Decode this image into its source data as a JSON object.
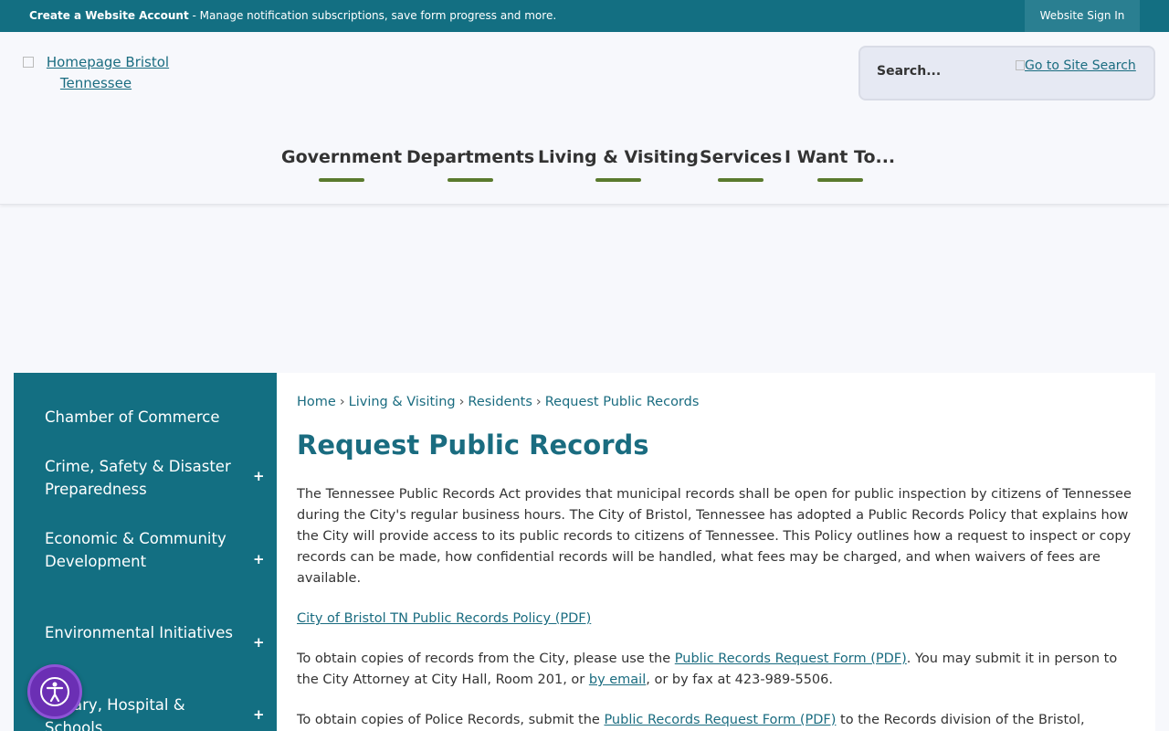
{
  "topbar": {
    "create_account": "Create a Website Account",
    "message": " - Manage notification subscriptions, save form progress and more.",
    "signin": "Website Sign In"
  },
  "header": {
    "logo_alt": "Homepage Bristol Tennessee",
    "search_placeholder": "Search...",
    "search_go": "Go to Site Search"
  },
  "nav": [
    "Government",
    "Departments",
    "Living & Visiting",
    "Services",
    "I Want To..."
  ],
  "sidebar": [
    {
      "label": "Chamber of Commerce",
      "expandable": false
    },
    {
      "label": "Crime, Safety & Disaster Preparedness",
      "expandable": true
    },
    {
      "label": "Economic & Community Development",
      "expandable": true
    },
    {
      "label": "Environmental Initiatives",
      "expandable": true
    },
    {
      "label": "Library, Hospital & Schools",
      "expandable": true
    }
  ],
  "breadcrumb": [
    "Home",
    "Living & Visiting",
    "Residents",
    "Request Public Records"
  ],
  "page_title": "Request Public Records",
  "content": {
    "intro": "The Tennessee Public Records Act provides that municipal records shall be open for public inspection by citizens of Tennessee during the City's regular business hours. The City of Bristol, Tennessee has adopted a Public Records Policy that explains how the City will provide access to its public records to citizens of Tennessee. This Policy outlines how a request to inspect or copy records can be made, how confidential records will be handled, what fees may be charged, and when waivers of fees are available.",
    "policy_link": "City of Bristol TN Public Records Policy (PDF)",
    "p2_a": "To obtain copies of records from the City, please use the ",
    "p2_link": "Public Records Request Form (PDF)",
    "p2_b": ". You may submit it in person to the City Attorney at City Hall, Room 201, or ",
    "p2_email": "by email",
    "p2_c": ", or by fax at 423-989-5506.",
    "p3_a": "To obtain copies of Police Records, submit the ",
    "p3_link": "Public Records Request Form (PDF)",
    "p3_b": " to the Records division of the Bristol,"
  },
  "colors": {
    "teal": "#136f82",
    "nav_underline": "#5a7a2e",
    "accessibility": "#6b2fb4"
  }
}
